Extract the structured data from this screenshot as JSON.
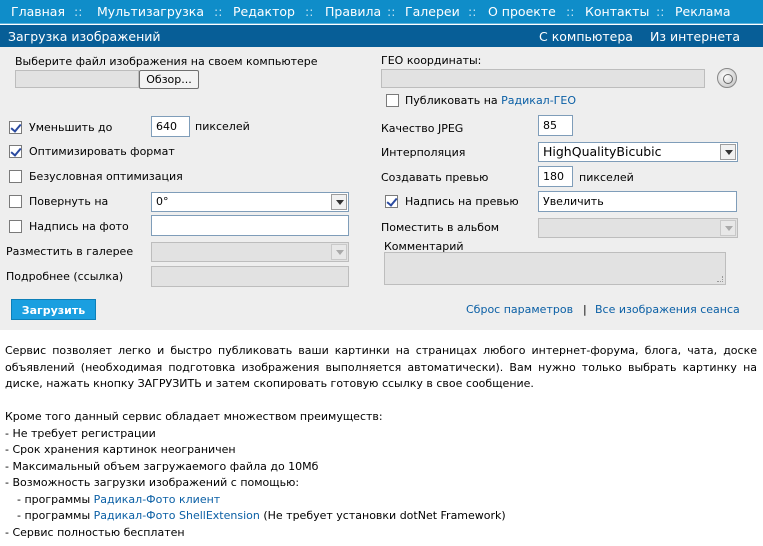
{
  "nav": {
    "items": [
      "Главная",
      "Мультизагрузка",
      "Редактор",
      "Правила",
      "Галереи",
      "О проекте",
      "Контакты",
      "Реклама"
    ],
    "separator": "::"
  },
  "subbar": {
    "title": "Загрузка изображений",
    "tabs": [
      "С компьютера",
      "Из интернета"
    ]
  },
  "form": {
    "file_label": "Выберите файл изображения на своем компьютере",
    "file_value": "",
    "browse_label": "Обзор...",
    "geo_label": "ГЕО координаты:",
    "geo_value": "",
    "publish_geo_prefix": "Публиковать на ",
    "publish_geo_link": "Радикал-ГЕО",
    "publish_geo_checked": false,
    "reduce_label": "Уменьшить до",
    "reduce_checked": true,
    "reduce_value": "640",
    "reduce_unit": "пикселей",
    "optimize_label": "Оптимизировать формат",
    "optimize_checked": true,
    "lossless_label": "Безусловная оптимизация",
    "lossless_checked": false,
    "rotate_label": "Повернуть на",
    "rotate_checked": false,
    "rotate_value": "0°",
    "caption_label": "Надпись на фото",
    "caption_checked": false,
    "caption_value": "",
    "gallery_label": "Разместить в галерее",
    "gallery_value": "",
    "details_label": "Подробнее (ссылка)",
    "details_value": "",
    "jpeg_label": "Качество JPEG",
    "jpeg_value": "85",
    "interp_label": "Интерполяция",
    "interp_value": "HighQualityBicubic",
    "preview_label": "Создавать превью",
    "preview_value": "180",
    "preview_unit": "пикселей",
    "preview_caption_label": "Надпись на превью",
    "preview_caption_checked": true,
    "preview_caption_value": "Увеличить",
    "album_label": "Поместить в альбом",
    "album_value": "",
    "comment_label": "Комментарий",
    "comment_value": "",
    "upload_label": "Загрузить",
    "reset_link": "Сброс параметров",
    "links_separator": "|",
    "session_link": "Все изображения сеанса"
  },
  "content": {
    "intro": "Сервис позволяет легко и быстро публиковать ваши картинки на страницах любого интернет-форума, блога, чата, доске объявлений (необходимая подготовка изображения выполняется автоматически). Вам нужно только выбрать картинку на диске, нажать кнопку ЗАГРУЗИТЬ и затем скопировать готовую ссылку в свое сообщение.",
    "advantages_heading": "Кроме того данный сервис обладает множеством преимуществ:",
    "adv1": "- Не требует регистрации",
    "adv2": "- Срок хранения картинок неограничен",
    "adv3": "- Максимальный объем загружаемого файла до 10Мб",
    "adv4": "- Возможность загрузки изображений с помощью:",
    "prog1_prefix": "- программы ",
    "prog1_link": "Радикал-Фото клиент",
    "prog2_prefix": "- программы ",
    "prog2_link": "Радикал-Фото ShellExtension",
    "prog2_suffix": " (Не требует установки dotNet Framework)",
    "adv5": "- Сервис полностью бесплатен"
  },
  "colors": {
    "nav_bg": "#0f8dc9",
    "subbar_bg": "#075e97",
    "form_bg": "#eeeeee",
    "button_bg": "#1a9fe0",
    "link": "#0a5fa5"
  }
}
